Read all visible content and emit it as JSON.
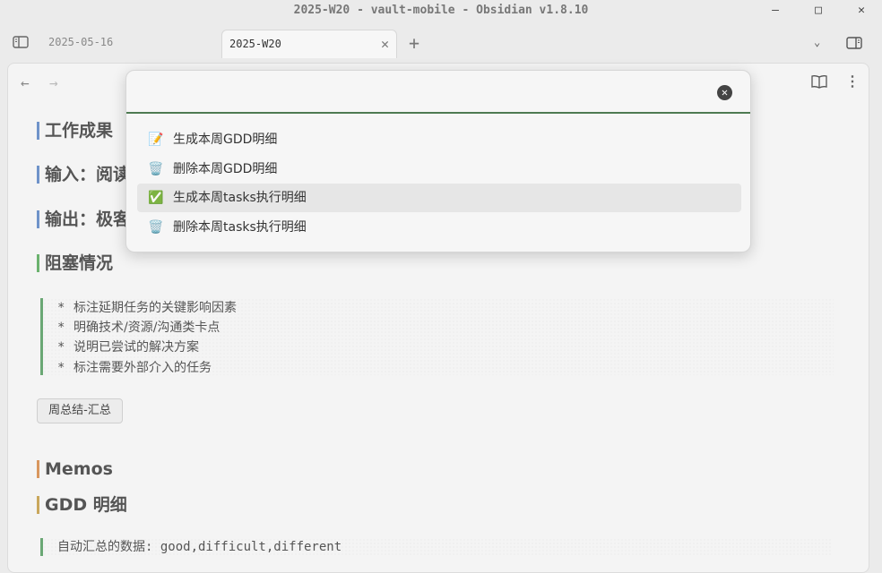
{
  "window": {
    "title": "2025-W20 - vault-mobile - Obsidian v1.8.10",
    "minimize": "—",
    "maximize": "□",
    "close": "✕"
  },
  "tabs": {
    "inactive_label": "2025-05-16",
    "active_label": "2025-W20",
    "close_glyph": "✕",
    "new_tab_glyph": "+",
    "list_glyph": "⌄"
  },
  "nav": {
    "back_glyph": "←",
    "forward_glyph": "→",
    "more_glyph": "⋮"
  },
  "headings": {
    "work": "工作成果",
    "input": "输入：阅读",
    "output": "输出：极客",
    "blockers": "阻塞情况",
    "memos": "Memos",
    "gdd": "GDD 明细"
  },
  "blockers_list": [
    "标注延期任务的关键影响因素",
    "明确技术/资源/沟通类卡点",
    "说明已尝试的解决方案",
    "标注需要外部介入的任务"
  ],
  "bullet_glyph": "*",
  "summary_button": "周总结-汇总",
  "auto_summary": "自动汇总的数据: good,difficult,different",
  "modal": {
    "close_glyph": "✕",
    "items": [
      {
        "emoji": "📝",
        "label": "生成本周GDD明细"
      },
      {
        "emoji": "🗑️",
        "label": "删除本周GDD明细"
      },
      {
        "emoji": "✅",
        "label": "生成本周tasks执行明细"
      },
      {
        "emoji": "🗑️",
        "label": "删除本周tasks执行明细"
      }
    ],
    "selected_index": 2
  },
  "colors": {
    "accent_green": "#4e7a52",
    "heading_blue": "#6f93c9",
    "heading_green": "#6bb26e",
    "heading_orange": "#d9965e",
    "heading_gold": "#c9a75c"
  }
}
